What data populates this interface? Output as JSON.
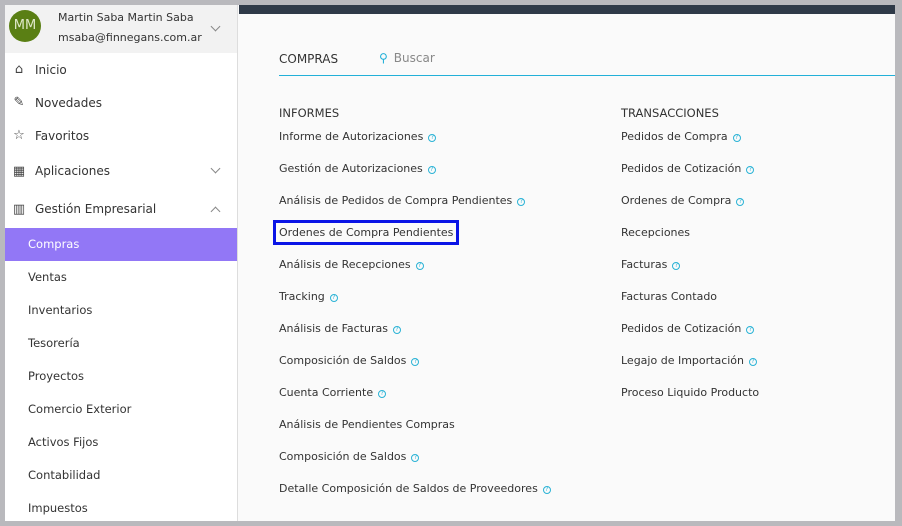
{
  "user": {
    "initials": "MM",
    "name": "Martin Saba Martin Saba",
    "email": "msaba@finnegans.com.ar"
  },
  "nav": [
    {
      "label": "Inicio",
      "icon": "home-icon",
      "glyph": "⌂"
    },
    {
      "label": "Novedades",
      "icon": "pin-icon",
      "glyph": "✎"
    },
    {
      "label": "Favoritos",
      "icon": "star-icon",
      "glyph": "☆"
    },
    {
      "label": "Aplicaciones",
      "icon": "apps-grid-icon",
      "glyph": "▦"
    },
    {
      "label": "Gestión Empresarial",
      "icon": "building-icon",
      "glyph": "▥"
    }
  ],
  "subnav": [
    "Compras",
    "Ventas",
    "Inventarios",
    "Tesorería",
    "Proyectos",
    "Comercio Exterior",
    "Activos Fijos",
    "Contabilidad",
    "Impuestos"
  ],
  "main": {
    "section": "COMPRAS",
    "search_placeholder": "Buscar",
    "informes_title": "INFORMES",
    "informes": [
      {
        "label": "Informe de Autorizaciones",
        "help": true
      },
      {
        "label": "Gestión de Autorizaciones",
        "help": true
      },
      {
        "label": "Análisis de Pedidos de Compra Pendientes",
        "help": true
      },
      {
        "label": "Ordenes de Compra Pendientes",
        "help": false,
        "highlighted": true
      },
      {
        "label": "Análisis de Recepciones",
        "help": true
      },
      {
        "label": "Tracking",
        "help": true
      },
      {
        "label": "Análisis de Facturas",
        "help": true
      },
      {
        "label": "Composición de Saldos",
        "help": true
      },
      {
        "label": "Cuenta Corriente",
        "help": true
      },
      {
        "label": "Análisis de Pendientes Compras",
        "help": false
      },
      {
        "label": "Composición de Saldos",
        "help": true
      },
      {
        "label": "Detalle Composición de Saldos de Proveedores",
        "help": true
      }
    ],
    "transacciones_title": "TRANSACCIONES",
    "transacciones": [
      {
        "label": "Pedidos de Compra",
        "help": true
      },
      {
        "label": "Pedidos de Cotización",
        "help": true
      },
      {
        "label": "Ordenes de Compra",
        "help": true
      },
      {
        "label": "Recepciones",
        "help": false
      },
      {
        "label": "Facturas",
        "help": true
      },
      {
        "label": "Facturas Contado",
        "help": false
      },
      {
        "label": "Pedidos de Cotización",
        "help": true
      },
      {
        "label": "Legajo de Importación",
        "help": true
      },
      {
        "label": "Proceso Liquido Producto",
        "help": false
      }
    ],
    "help_glyph": "?"
  }
}
